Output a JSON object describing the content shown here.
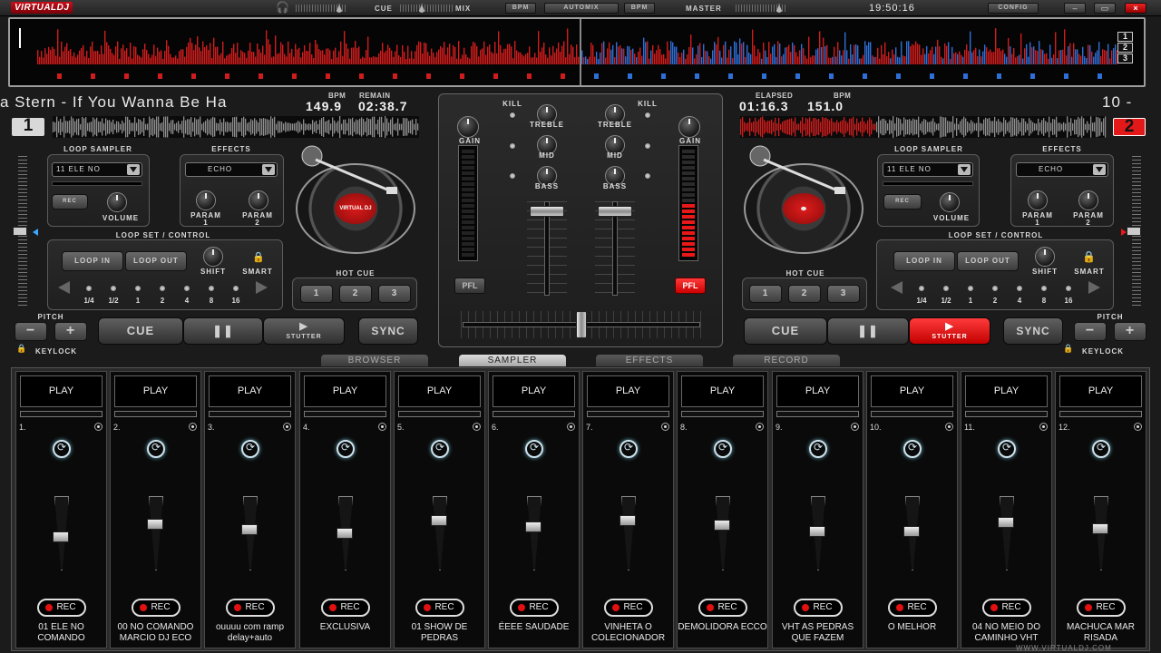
{
  "titlebar": {
    "logo": "VIRTUALDJ",
    "cue_label": "CUE",
    "mix_label": "MIX",
    "bpm_left": "BPM",
    "automix": "AUTOMIX",
    "bpm_right": "BPM",
    "master_label": "MASTER",
    "clock": "19:50:16",
    "config": "CONFIG",
    "minimize": "–",
    "maximize": "▭",
    "close": "×"
  },
  "overview": {
    "deck_buttons": [
      "1",
      "2",
      "3"
    ]
  },
  "deck1": {
    "title": "a Stern - If You Wanna Be Ha",
    "bpm_label": "BPM",
    "bpm": "149.9",
    "remain_label": "REMAIN",
    "remain": "02:38.7",
    "number": "1",
    "loop_sampler_label": "LOOP SAMPLER",
    "sampler_select": "11 ELE NO",
    "rec_label": "REC",
    "volume_label": "VOLUME",
    "effects_label": "EFFECTS",
    "effect_select": "ECHO",
    "param1": "PARAM\n1",
    "param2": "PARAM\n2",
    "loopset_label": "LOOP SET / CONTROL",
    "loop_in": "LOOP IN",
    "loop_out": "LOOP OUT",
    "shift": "SHIFT",
    "smart": "SMART",
    "loop_sizes": [
      "1/4",
      "1/2",
      "1",
      "2",
      "4",
      "8",
      "16"
    ],
    "hotcue_label": "HOT CUE",
    "hotcues": [
      "1",
      "2",
      "3"
    ],
    "pitch_label": "PITCH",
    "minus": "−",
    "plus": "+",
    "keylock": "KEYLOCK",
    "cue": "CUE",
    "pause": "❚❚",
    "stutter": "STUTTER",
    "sync": "SYNC",
    "platter_label": "VIRTUAL DJ",
    "stutter_active": false
  },
  "deck2": {
    "title": "10 -",
    "elapsed_label": "ELAPSED",
    "elapsed": "01:16.3",
    "bpm_label": "BPM",
    "bpm": "151.0",
    "number": "2",
    "loop_sampler_label": "LOOP SAMPLER",
    "sampler_select": "11 ELE NO",
    "rec_label": "REC",
    "volume_label": "VOLUME",
    "effects_label": "EFFECTS",
    "effect_select": "ECHO",
    "param1": "PARAM\n1",
    "param2": "PARAM\n2",
    "loopset_label": "LOOP SET / CONTROL",
    "loop_in": "LOOP IN",
    "loop_out": "LOOP OUT",
    "shift": "SHIFT",
    "smart": "SMART",
    "loop_sizes": [
      "1/4",
      "1/2",
      "1",
      "2",
      "4",
      "8",
      "16"
    ],
    "hotcue_label": "HOT CUE",
    "hotcues": [
      "1",
      "2",
      "3"
    ],
    "pitch_label": "PITCH",
    "minus": "−",
    "plus": "+",
    "keylock": "KEYLOCK",
    "cue": "CUE",
    "pause": "❚❚",
    "stutter": "STUTTER",
    "sync": "SYNC",
    "stutter_active": true
  },
  "mixer": {
    "kill": "KILL",
    "gain": "GAIN",
    "treble": "TREBLE",
    "mid": "MID",
    "bass": "BASS",
    "pfl": "PFL",
    "channel_fader_1": 0.95,
    "channel_fader_2": 0.95,
    "crossfader": 0.5
  },
  "tabs": [
    "BROWSER",
    "SAMPLER",
    "EFFECTS",
    "RECORD"
  ],
  "active_tab": "SAMPLER",
  "sampler": {
    "play_label": "PLAY",
    "rec_label": "REC",
    "slots": [
      {
        "num": "1.",
        "name": "01 ELE NO COMANDO",
        "volume": 0.45
      },
      {
        "num": "2.",
        "name": "00 NO COMANDO MARCIO DJ ECO",
        "volume": 0.65
      },
      {
        "num": "3.",
        "name": "ouuuu com ramp delay+auto",
        "volume": 0.55
      },
      {
        "num": "4.",
        "name": "EXCLUSIVA",
        "volume": 0.5
      },
      {
        "num": "5.",
        "name": "01 SHOW DE PEDRAS",
        "volume": 0.7
      },
      {
        "num": "6.",
        "name": "ÉEEE SAUDADE",
        "volume": 0.6
      },
      {
        "num": "7.",
        "name": "VINHETA  O COLECIONADOR",
        "volume": 0.7
      },
      {
        "num": "8.",
        "name": "DEMOLIDORA ECCO",
        "volume": 0.63
      },
      {
        "num": "9.",
        "name": "VHT AS PEDRAS QUE FAZEM",
        "volume": 0.53
      },
      {
        "num": "10.",
        "name": "O MELHOR",
        "volume": 0.53
      },
      {
        "num": "11.",
        "name": "04 NO MEIO DO CAMINHO VHT",
        "volume": 0.67
      },
      {
        "num": "12.",
        "name": "MACHUCA MAR RISADA",
        "volume": 0.57
      }
    ]
  },
  "colors": {
    "accent_red": "#e81818",
    "deck2_waveform": "#d01c1c",
    "deck1_waveform": "#9a9a9a"
  },
  "website": "WWW.VIRTUALDJ.COM"
}
